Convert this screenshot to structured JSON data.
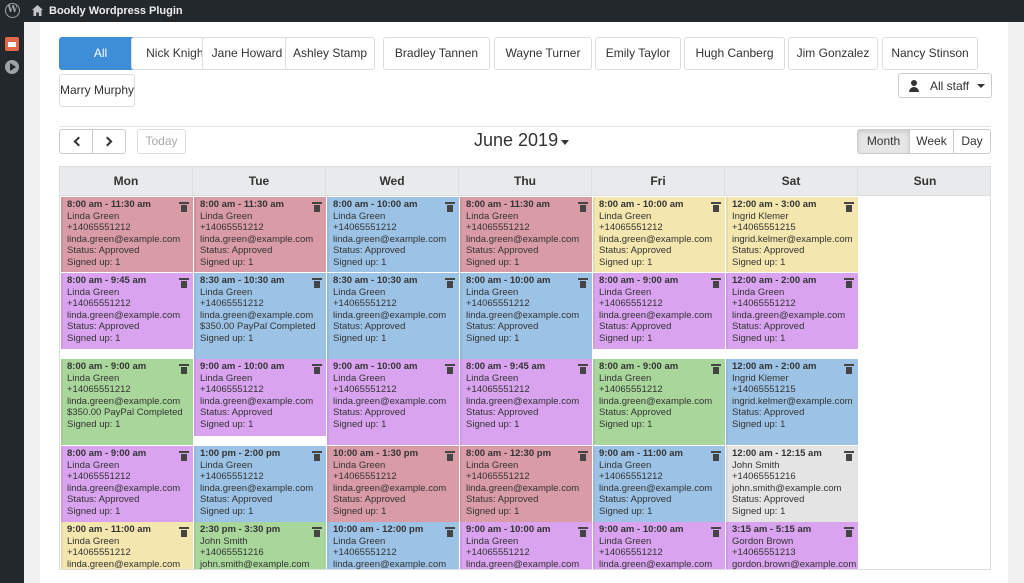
{
  "adminbar": {
    "site_title": "Bookly Wordpress Plugin",
    "wp_logo": "wordpress-logo",
    "home_icon": "home-icon"
  },
  "sidebar_icons": [
    "calendar-icon",
    "play-icon"
  ],
  "staff_tabs": [
    "All",
    "Nick Knight",
    "Jane Howard",
    "Ashley Stamp",
    "Bradley Tannen",
    "Wayne Turner",
    "Emily Taylor",
    "Hugh Canberg",
    "Jim Gonzalez",
    "Nancy Stinson",
    "Marry Murphy"
  ],
  "staff_filter": {
    "label": "All staff",
    "icon": "user-icon"
  },
  "toolbar": {
    "today": "Today",
    "title": "June 2019",
    "views": [
      "Month",
      "Week",
      "Day"
    ],
    "active_view": "Month"
  },
  "day_names": [
    "Mon",
    "Tue",
    "Wed",
    "Thu",
    "Fri",
    "Sat",
    "Sun"
  ],
  "colors": {
    "red": "#d99ba6",
    "blue": "#9cc3e6",
    "yellow": "#f3e6ae",
    "violet": "#d9a3f0",
    "green": "#a9d79b",
    "gray": "#e4e4e4",
    "accent": "#3d8ed6"
  },
  "events": [
    [
      {
        "color": "red",
        "lines": [
          "8:00 am - 11:30 am",
          "Linda Green",
          "+14065551212",
          "linda.green@example.com",
          "Status: Approved",
          "Signed up: 1"
        ]
      },
      {
        "color": "red",
        "lines": [
          "8:00 am - 11:30 am",
          "Linda Green",
          "+14065551212",
          "linda.green@example.com",
          "Status: Approved",
          "Signed up: 1"
        ]
      },
      {
        "color": "blue",
        "lines": [
          "8:00 am - 10:00 am",
          "Linda Green",
          "+14065551212",
          "linda.green@example.com",
          "Status: Approved",
          "Signed up: 1"
        ]
      },
      {
        "color": "red",
        "lines": [
          "8:00 am - 11:30 am",
          "Linda Green",
          "+14065551212",
          "linda.green@example.com",
          "Status: Approved",
          "Signed up: 1"
        ]
      },
      {
        "color": "yellow",
        "lines": [
          "8:00 am - 10:00 am",
          "Linda Green",
          "+14065551212",
          "linda.green@example.com",
          "Status: Approved",
          "Signed up: 1"
        ]
      },
      {
        "color": "yellow",
        "lines": [
          "12:00 am - 3:00 am",
          "Ingrid Klemer",
          "+14065551215",
          "ingrid.kelmer@example.com",
          "Status: Approved",
          "Signed up: 1"
        ]
      }
    ],
    [
      {
        "color": "violet",
        "lines": [
          "8:00 am - 9:45 am",
          "Linda Green",
          "+14065551212",
          "linda.green@example.com",
          "Status: Approved",
          "Signed up: 1"
        ]
      },
      {
        "color": "blue",
        "lines": [
          "8:30 am - 10:30 am",
          "Linda Green",
          "+14065551212",
          "linda.green@example.com",
          "$350.00 PayPal Completed",
          "Signed up: 1"
        ]
      },
      {
        "color": "blue",
        "lines": [
          "8:30 am - 10:30 am",
          "Linda Green",
          "+14065551212",
          "linda.green@example.com",
          "Status: Approved",
          "Signed up: 1"
        ]
      },
      {
        "color": "blue",
        "lines": [
          "8:00 am - 10:00 am",
          "Linda Green",
          "+14065551212",
          "linda.green@example.com",
          "Status: Approved",
          "Signed up: 1"
        ]
      },
      {
        "color": "violet",
        "lines": [
          "8:00 am - 9:00 am",
          "Linda Green",
          "+14065551212",
          "linda.green@example.com",
          "Status: Approved",
          "Signed up: 1"
        ]
      },
      {
        "color": "violet",
        "lines": [
          "12:00 am - 2:00 am",
          "Linda Green",
          "+14065551212",
          "linda.green@example.com",
          "Status: Approved",
          "Signed up: 1"
        ]
      }
    ],
    [
      {
        "color": "green",
        "lines": [
          "8:00 am - 9:00 am",
          "Linda Green",
          "+14065551212",
          "linda.green@example.com",
          "$350.00 PayPal Completed",
          "Signed up: 1"
        ]
      },
      {
        "color": "violet",
        "lines": [
          "9:00 am - 10:00 am",
          "Linda Green",
          "+14065551212",
          "linda.green@example.com",
          "Status: Approved",
          "Signed up: 1"
        ]
      },
      {
        "color": "violet",
        "lines": [
          "9:00 am - 10:00 am",
          "Linda Green",
          "+14065551212",
          "linda.green@example.com",
          "Status: Approved",
          "Signed up: 1"
        ]
      },
      {
        "color": "violet",
        "lines": [
          "8:00 am - 9:45 am",
          "Linda Green",
          "+14065551212",
          "linda.green@example.com",
          "Status: Approved",
          "Signed up: 1"
        ]
      },
      {
        "color": "green",
        "lines": [
          "8:00 am - 9:00 am",
          "Linda Green",
          "+14065551212",
          "linda.green@example.com",
          "Status: Approved",
          "Signed up: 1"
        ]
      },
      {
        "color": "blue",
        "lines": [
          "12:00 am - 2:00 am",
          "Ingrid Klemer",
          "+14065551215",
          "ingrid.kelmer@example.com",
          "Status: Approved",
          "Signed up: 1"
        ]
      }
    ],
    [
      {
        "color": "violet",
        "lines": [
          "8:00 am - 9:00 am",
          "Linda Green",
          "+14065551212",
          "linda.green@example.com",
          "Status: Approved",
          "Signed up: 1"
        ]
      },
      {
        "color": "blue",
        "lines": [
          "1:00 pm - 2:00 pm",
          "Linda Green",
          "+14065551212",
          "linda.green@example.com",
          "Status: Approved",
          "Signed up: 1"
        ]
      },
      {
        "color": "red",
        "lines": [
          "10:00 am - 1:30 pm",
          "Linda Green",
          "+14065551212",
          "linda.green@example.com",
          "Status: Approved",
          "Signed up: 1"
        ]
      },
      {
        "color": "red",
        "lines": [
          "8:00 am - 12:30 pm",
          "Linda Green",
          "+14065551212",
          "linda.green@example.com",
          "Status: Approved",
          "Signed up: 1"
        ]
      },
      {
        "color": "blue",
        "lines": [
          "9:00 am - 11:00 am",
          "Linda Green",
          "+14065551212",
          "linda.green@example.com",
          "Status: Approved",
          "Signed up: 1"
        ]
      },
      {
        "color": "gray",
        "lines": [
          "12:00 am - 12:15 am",
          "John Smith",
          "+14065551216",
          "john.smith@example.com",
          "Status: Approved",
          "Signed up: 1"
        ]
      }
    ],
    [
      {
        "color": "yellow",
        "lines": [
          "9:00 am - 11:00 am",
          "Linda Green",
          "+14065551212",
          "linda.green@example.com"
        ]
      },
      {
        "color": "green",
        "lines": [
          "2:30 pm - 3:30 pm",
          "John Smith",
          "+14065551216",
          "john.smith@example.com"
        ]
      },
      {
        "color": "blue",
        "lines": [
          "10:00 am - 12:00 pm",
          "Linda Green",
          "+14065551212",
          "linda.green@example.com"
        ]
      },
      {
        "color": "violet",
        "lines": [
          "9:00 am - 10:00 am",
          "Linda Green",
          "+14065551212",
          "linda.green@example.com"
        ]
      },
      {
        "color": "violet",
        "lines": [
          "9:00 am - 10:00 am",
          "Linda Green",
          "+14065551212",
          "linda.green@example.com"
        ]
      },
      {
        "color": "violet",
        "lines": [
          "3:15 am - 5:15 am",
          "Gordon Brown",
          "+14065551213",
          "gordon.brown@example.com"
        ]
      }
    ]
  ]
}
